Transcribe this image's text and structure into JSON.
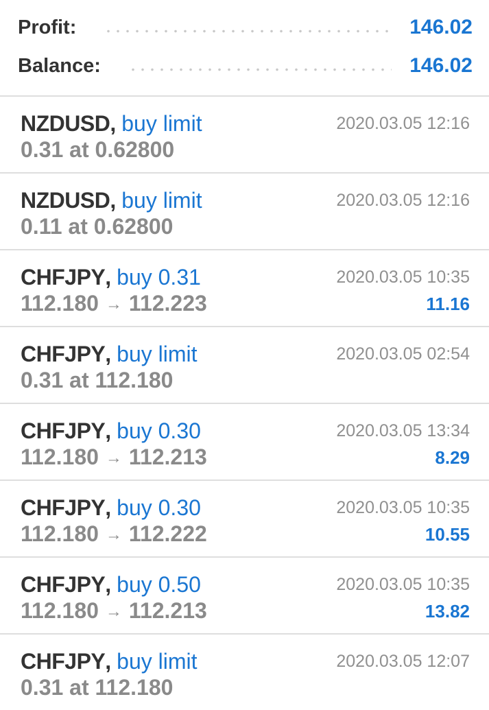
{
  "summary": {
    "profit_label": "Profit:",
    "profit_value": "146.02",
    "balance_label": "Balance:",
    "balance_value": "146.02"
  },
  "orders": [
    {
      "symbol": "NZDUSD",
      "type": "buy limit",
      "details": "0.31 at 0.62800",
      "time": "2020.03.05 12:16",
      "profit": ""
    },
    {
      "symbol": "NZDUSD",
      "type": "buy limit",
      "details": "0.11 at 0.62800",
      "time": "2020.03.05 12:16",
      "profit": ""
    },
    {
      "symbol": "CHFJPY",
      "type": "buy 0.31",
      "open_price": "112.180",
      "close_price": "112.223",
      "time": "2020.03.05 10:35",
      "profit": "11.16"
    },
    {
      "symbol": "CHFJPY",
      "type": "buy limit",
      "details": "0.31 at 112.180",
      "time": "2020.03.05 02:54",
      "profit": ""
    },
    {
      "symbol": "CHFJPY",
      "type": "buy 0.30",
      "open_price": "112.180",
      "close_price": "112.213",
      "time": "2020.03.05 13:34",
      "profit": "8.29"
    },
    {
      "symbol": "CHFJPY",
      "type": "buy 0.30",
      "open_price": "112.180",
      "close_price": "112.222",
      "time": "2020.03.05 10:35",
      "profit": "10.55"
    },
    {
      "symbol": "CHFJPY",
      "type": "buy 0.50",
      "open_price": "112.180",
      "close_price": "112.213",
      "time": "2020.03.05 10:35",
      "profit": "13.82"
    },
    {
      "symbol": "CHFJPY",
      "type": "buy limit",
      "details": "0.31 at 112.180",
      "time": "2020.03.05 12:07",
      "profit": ""
    }
  ],
  "symbols": {
    "comma": ",",
    "arrow": "→"
  },
  "colors": {
    "accent": "#1a76d2",
    "primary_text": "#333333",
    "secondary_text": "#8a8a8a",
    "divider": "#dedede"
  },
  "icons": {
    "price_arrow": "right-arrow-icon"
  }
}
